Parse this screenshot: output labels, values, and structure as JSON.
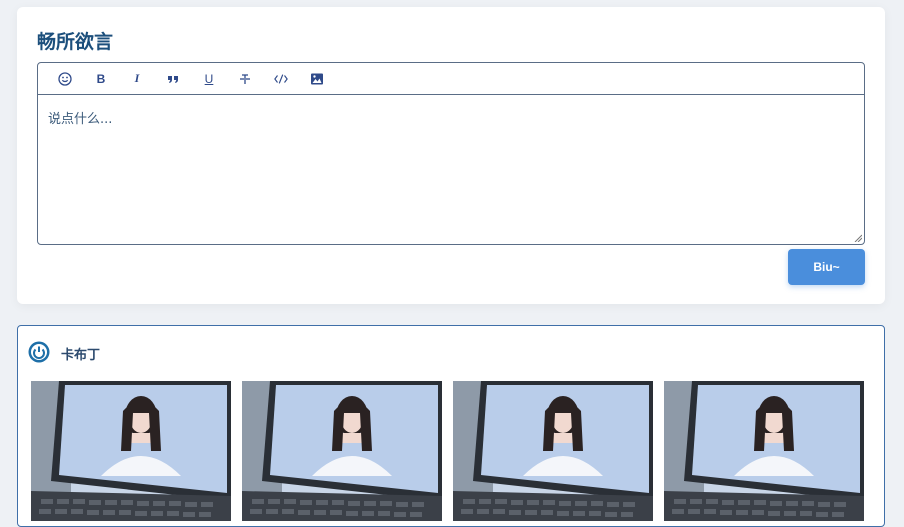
{
  "editor": {
    "title": "畅所欲言",
    "placeholder": "说点什么...",
    "submit_label": "Biu~",
    "toolbar": [
      {
        "name": "emoji-icon",
        "label": ""
      },
      {
        "name": "bold-icon",
        "label": "B"
      },
      {
        "name": "italic-icon",
        "label": "I"
      },
      {
        "name": "quote-icon",
        "label": ""
      },
      {
        "name": "underline-icon",
        "label": "U"
      },
      {
        "name": "strikethrough-icon",
        "label": ""
      },
      {
        "name": "code-icon",
        "label": ""
      },
      {
        "name": "image-icon",
        "label": ""
      }
    ]
  },
  "post": {
    "author": "卡布丁",
    "images": [
      "photo-1",
      "photo-2",
      "photo-3",
      "photo-4"
    ]
  },
  "colors": {
    "accent": "#4a8edc",
    "title": "#1c4f7c",
    "border": "#3f6fa8"
  }
}
